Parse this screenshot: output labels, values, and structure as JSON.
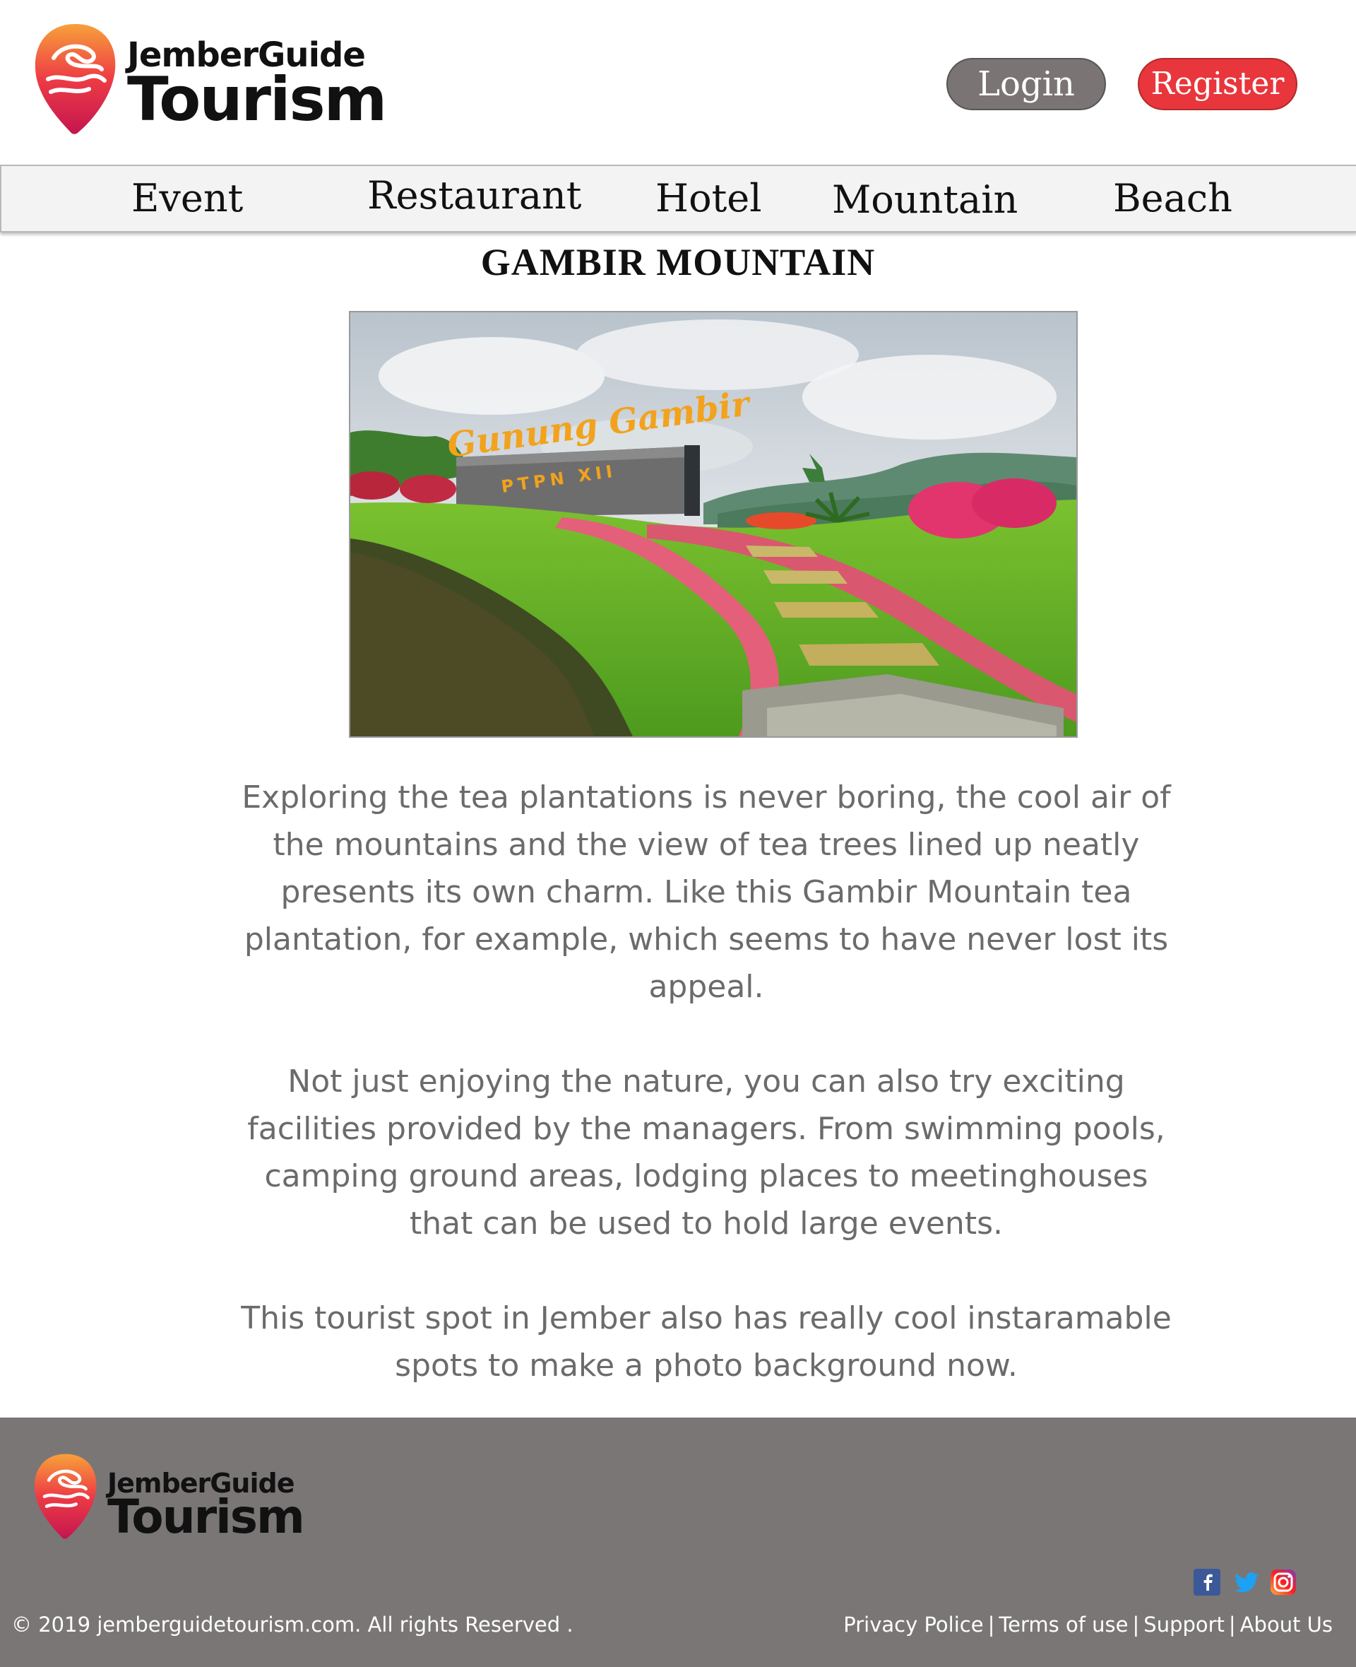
{
  "header": {
    "logo_brand": "JemberGuide",
    "logo_name": "Tourism",
    "login_label": "Login",
    "register_label": "Register"
  },
  "nav": {
    "items": [
      {
        "label": "Event"
      },
      {
        "label": "Restaurant"
      },
      {
        "label": "Hotel"
      },
      {
        "label": "Mountain"
      },
      {
        "label": "Beach"
      }
    ]
  },
  "main": {
    "title": "GAMBIR MOUNTAIN",
    "hero_sign_line1": "Gunung Gambir",
    "hero_sign_line2": "PTPN XII",
    "paragraphs": [
      "Exploring the tea plantations is never boring, the cool air of the mountains and the view of tea trees lined up neatly presents its own charm. Like this Gambir Mountain tea plantation, for example, which seems to have never lost its appeal.",
      "Not just enjoying the nature, you can also try exciting facilities provided by the managers. From swimming pools, camping ground areas, lodging places to meetinghouses that can be used to hold large events.",
      "This tourist spot in Jember also has really cool instaramable spots to make a photo background now."
    ]
  },
  "footer": {
    "logo_brand": "JemberGuide",
    "logo_name": "Tourism",
    "social": [
      {
        "icon": "facebook-icon",
        "color": "#3b5998"
      },
      {
        "icon": "twitter-icon",
        "color": "#1da1f2"
      },
      {
        "icon": "instagram-icon",
        "color": "#e1306c"
      }
    ],
    "copyright": "© 2019 jemberguidetourism.com. All rights Reserved .",
    "links": [
      {
        "label": "Privacy Police"
      },
      {
        "label": "Terms of use"
      },
      {
        "label": "Support"
      },
      {
        "label": "About Us"
      }
    ]
  },
  "colors": {
    "login_button": "#7a7474",
    "register_button": "#e8363c",
    "nav_background": "#f4f3f3",
    "footer_background": "#7a7676",
    "body_text": "#6b6b6b"
  }
}
